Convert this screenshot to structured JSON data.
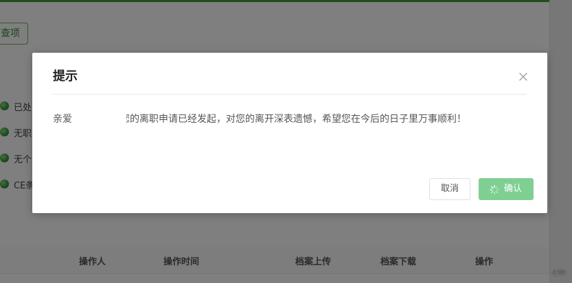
{
  "background": {
    "button_label": "查项",
    "list_items": [
      "已处",
      "无职",
      "无个",
      "CE条"
    ],
    "table_headers": [
      "操作人",
      "操作时间",
      "档案上传",
      "档案下载",
      "操作"
    ],
    "corner_chip": "0.5秒"
  },
  "dialog": {
    "title": "提示",
    "message": "亲爱的小伙伴，您的离职申请已经发起，对您的离开深表遗憾，希望您在今后的日子里万事顺利！",
    "cancel_label": "取消",
    "confirm_label": "确认",
    "close_icon": "close-icon",
    "loading_icon": "loading-spinner-icon"
  },
  "colors": {
    "brand_green": "#3a9c3a",
    "confirm_button": "#7fcf93",
    "overlay": "rgba(0,0,0,0.5)"
  }
}
